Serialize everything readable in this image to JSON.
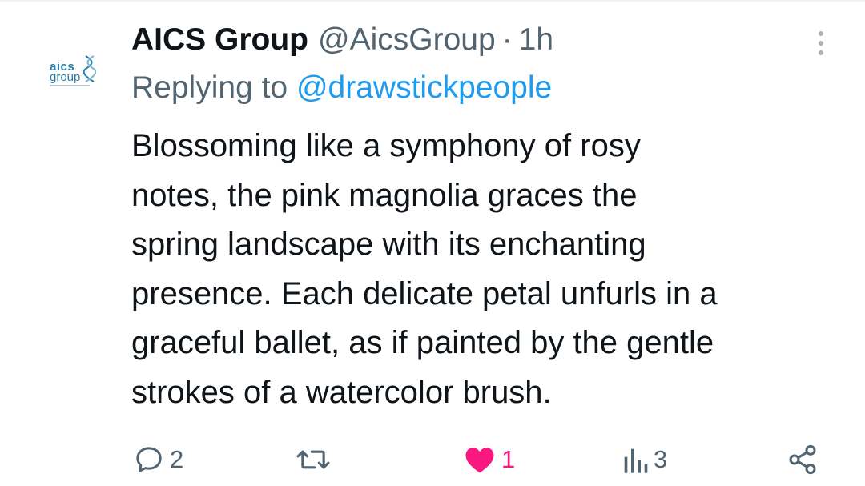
{
  "tweet": {
    "author_name": "AICS Group",
    "author_handle": "@AicsGroup",
    "separator": "·",
    "time": "1h",
    "reply_prefix": "Replying to",
    "reply_to": "@drawstickpeople",
    "body_lines": [
      "Blossoming like a symphony of rosy",
      "notes, the pink magnolia graces the",
      "spring landscape with its enchanting",
      "presence. Each delicate petal unfurls in a",
      "graceful ballet, as if painted by the gentle",
      "strokes of a watercolor brush."
    ]
  },
  "avatar": {
    "logo_word_1": "aics",
    "logo_word_2": "group"
  },
  "actions": {
    "reply_count": "2",
    "retweet_count": "",
    "like_count": "1",
    "views_count": "3"
  },
  "icons": {
    "more": "more-vertical-icon",
    "reply": "reply-bubble-icon",
    "retweet": "retweet-icon",
    "like": "heart-filled-icon",
    "views": "views-chart-icon",
    "share": "share-icon"
  },
  "colors": {
    "text": "#0f1419",
    "secondary": "#536471",
    "link": "#1d9bf0",
    "like": "#f91880",
    "logo": "#2a7fa8"
  }
}
